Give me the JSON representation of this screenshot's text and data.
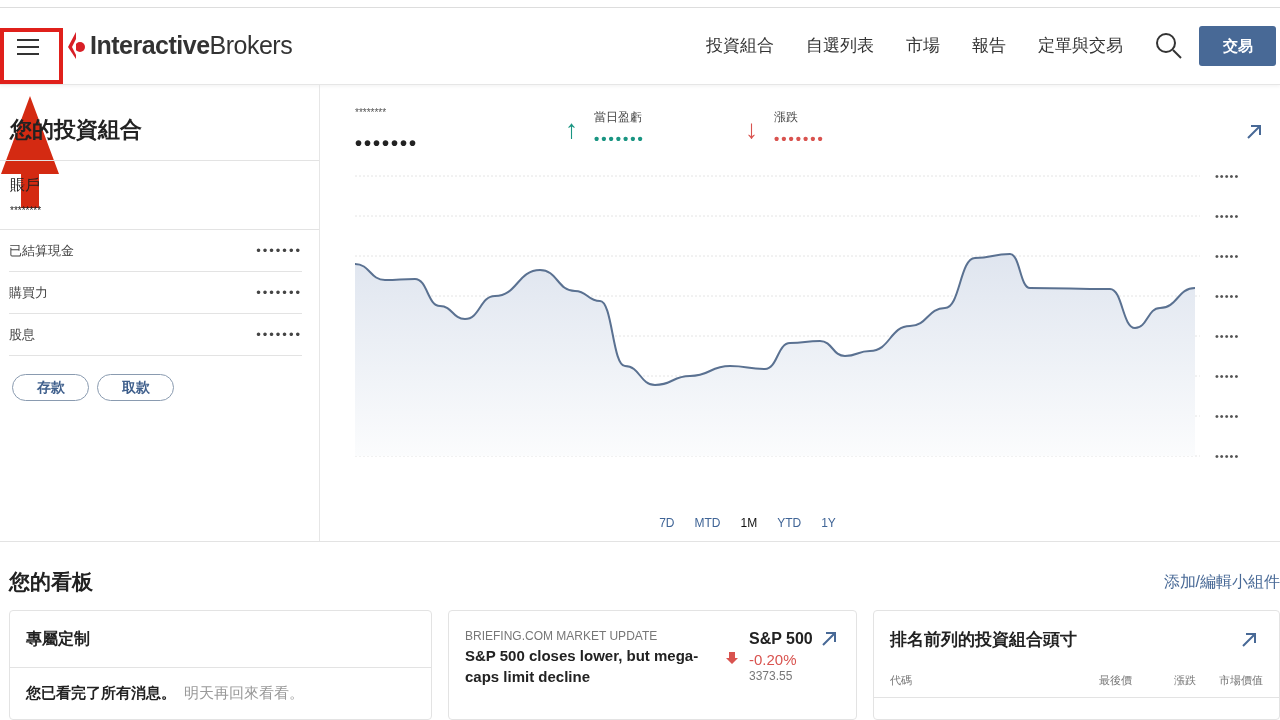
{
  "header": {
    "brand": "**Interactive**Brokers",
    "nav": [
      "投資組合",
      "自選列表",
      "市場",
      "報告",
      "定單與交易"
    ],
    "trade_button": "交易"
  },
  "portfolio": {
    "title": "您的投資組合",
    "account_label": "賬戶",
    "account_id": "********",
    "rows": [
      {
        "label": "已結算現金",
        "value": "•••••••"
      },
      {
        "label": "購買力",
        "value": "•••••••"
      },
      {
        "label": "股息",
        "value": "•••••••"
      }
    ],
    "buttons": [
      "存款",
      "取款"
    ]
  },
  "performance": {
    "total_label": "********",
    "total_value": "•••••••",
    "stats": [
      {
        "arrow": "↑",
        "label": "當日盈虧",
        "value": "•••••••",
        "color": "#1a9582"
      },
      {
        "arrow": "↓",
        "label": "漲跌",
        "value": "•••••••",
        "color": "#d9534f"
      }
    ],
    "y_labels": [
      "•••••",
      "•••••",
      "•••••",
      "•••••",
      "•••••",
      "•••••",
      "•••••",
      "•••••"
    ],
    "ranges": [
      {
        "label": "7D",
        "selected": false
      },
      {
        "label": "MTD",
        "selected": false
      },
      {
        "label": "1M",
        "selected": true
      },
      {
        "label": "YTD",
        "selected": false
      },
      {
        "label": "1Y",
        "selected": false
      }
    ]
  },
  "dashboard": {
    "title": "您的看板",
    "edit_link": "添加/編輯小組件",
    "widgets": [
      {
        "kind": "message",
        "title": "專屬定制",
        "message": "您已看完了所有消息。",
        "hint": "明天再回來看看。"
      },
      {
        "kind": "news",
        "source": "BRIEFING.COM MARKET UPDATE",
        "headline": "S&P 500 closes lower, but mega-caps limit decline",
        "index_name": "S&P 500",
        "change": "-0.20%",
        "color": "#d9534f",
        "price": "3373.55"
      },
      {
        "kind": "table",
        "title": "排名前列的投資組合頭寸",
        "columns": [
          "代碼",
          "最後價",
          "漲跌",
          "市場價值"
        ]
      }
    ]
  }
}
